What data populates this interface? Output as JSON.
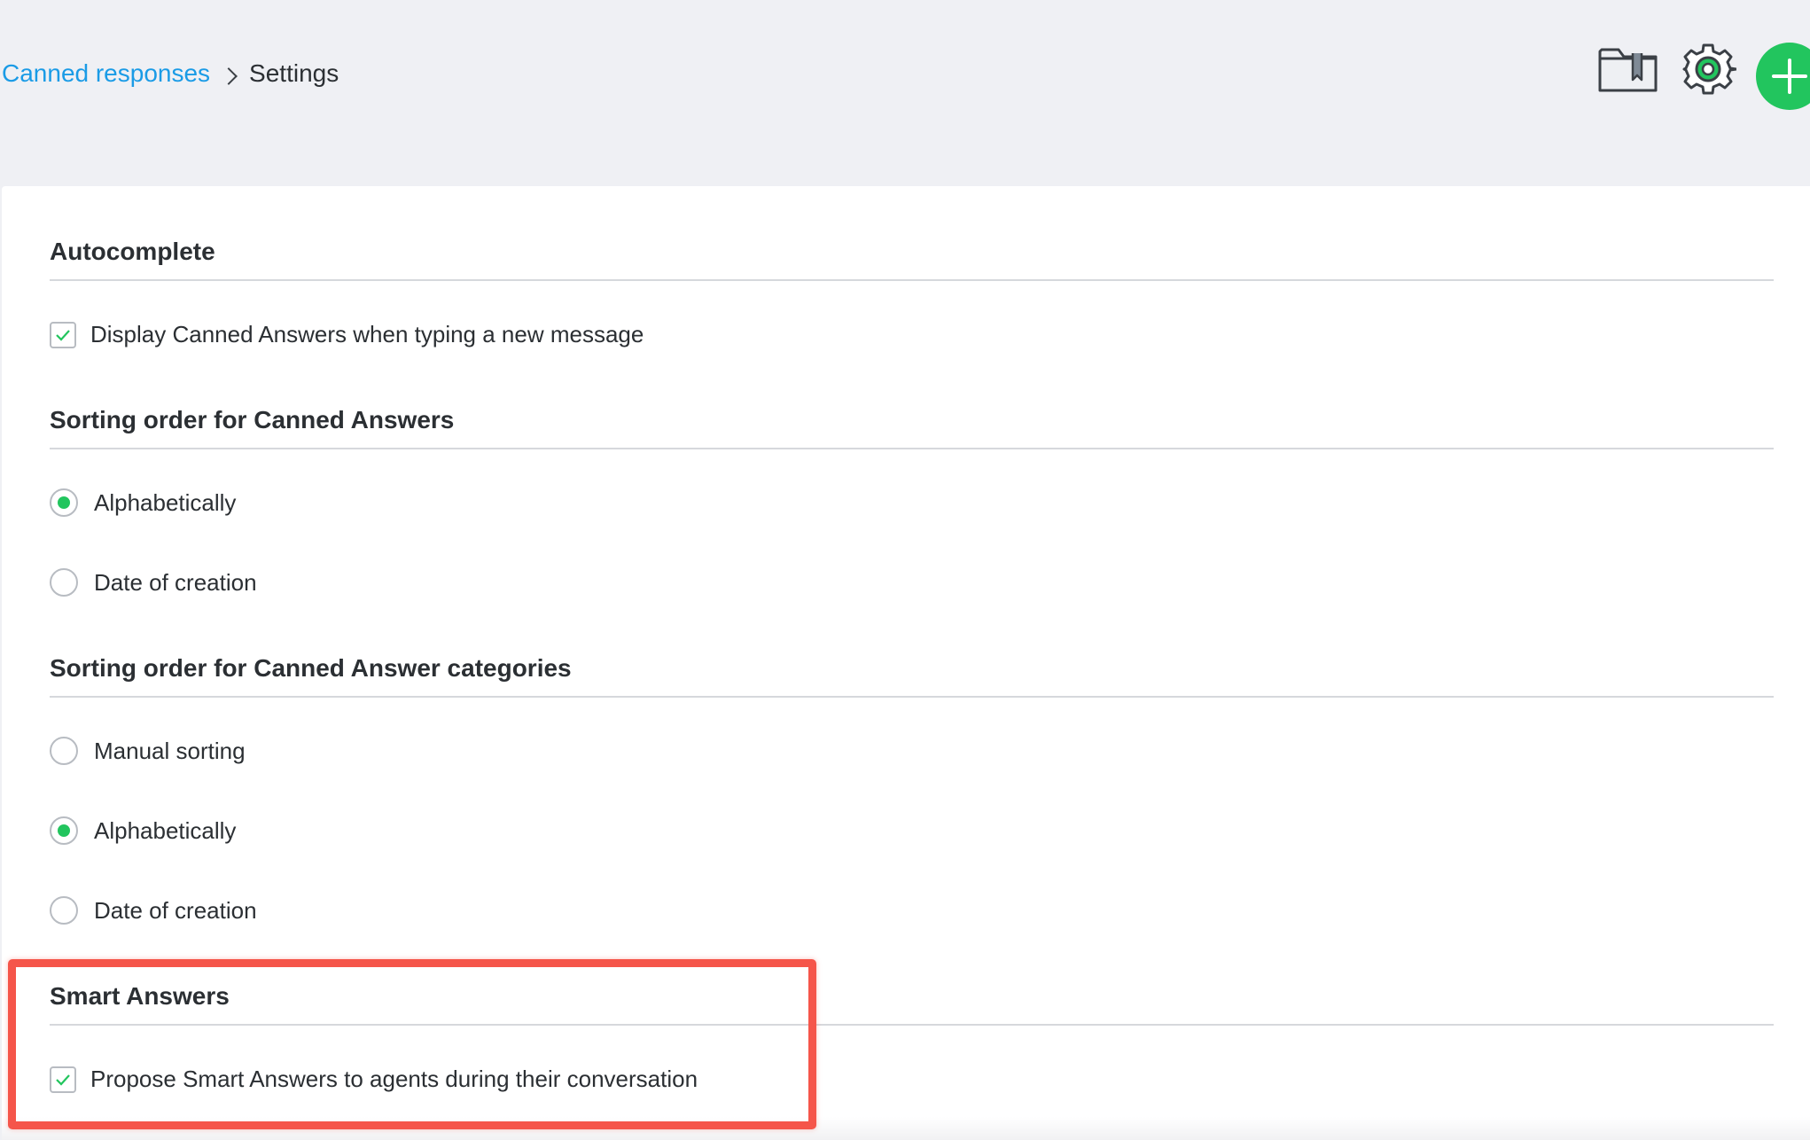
{
  "breadcrumb": {
    "parent": "Canned responses",
    "current": "Settings"
  },
  "toolbar": {
    "icons": [
      "folder-bookmark-icon",
      "gear-icon",
      "plus-icon"
    ],
    "accent_color": "#22c55e"
  },
  "sections": {
    "autocomplete": {
      "title": "Autocomplete",
      "options": [
        {
          "label": "Display Canned Answers when typing a new message",
          "checked": true
        }
      ]
    },
    "answer_sorting": {
      "title": "Sorting order for Canned Answers",
      "options": [
        {
          "label": "Alphabetically",
          "selected": true
        },
        {
          "label": "Date of creation",
          "selected": false
        }
      ]
    },
    "category_sorting": {
      "title": "Sorting order for Canned Answer categories",
      "options": [
        {
          "label": "Manual sorting",
          "selected": false
        },
        {
          "label": "Alphabetically",
          "selected": true
        },
        {
          "label": "Date of creation",
          "selected": false
        }
      ]
    },
    "smart_answers": {
      "title": "Smart Answers",
      "options": [
        {
          "label": "Propose Smart Answers to agents during their conversation",
          "checked": true
        }
      ]
    }
  },
  "highlight_color": "#f5554a",
  "link_color": "#1a9be6"
}
